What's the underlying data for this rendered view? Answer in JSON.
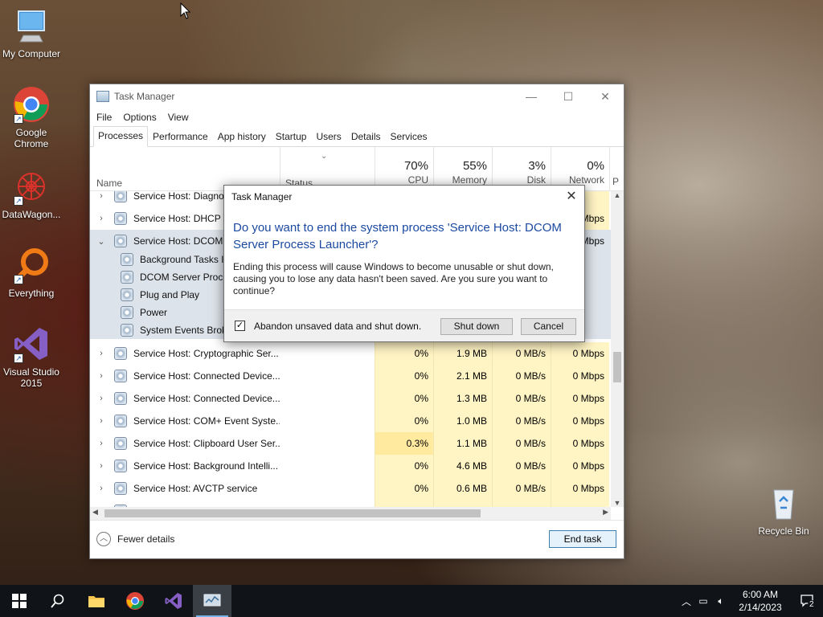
{
  "desktop_icons": [
    {
      "label": "My Computer",
      "icon": "computer-icon"
    },
    {
      "label": "Google Chrome",
      "icon": "chrome-icon"
    },
    {
      "label": "DataWagon...",
      "icon": "datawagon-icon"
    },
    {
      "label": "Everything",
      "icon": "search-magnifier-icon"
    },
    {
      "label": "Visual Studio 2015",
      "icon": "visual-studio-icon"
    },
    {
      "label": "Recycle Bin",
      "icon": "recycle-bin-icon"
    }
  ],
  "task_manager": {
    "title": "Task Manager",
    "menu": [
      "File",
      "Options",
      "View"
    ],
    "tabs": [
      "Processes",
      "Performance",
      "App history",
      "Startup",
      "Users",
      "Details",
      "Services"
    ],
    "active_tab": "Processes",
    "columns": {
      "name": "Name",
      "status": "Status",
      "cpu": {
        "pct": "70%",
        "label": "CPU"
      },
      "memory": {
        "pct": "55%",
        "label": "Memory"
      },
      "disk": {
        "pct": "3%",
        "label": "Disk"
      },
      "network": {
        "pct": "0%",
        "label": "Network"
      },
      "power_label": "P"
    },
    "rows": [
      {
        "chevron": "›",
        "name": "Service Host: Diagno",
        "cpu": "",
        "memory": "",
        "disk": "",
        "network": "",
        "child": false
      },
      {
        "chevron": "›",
        "name": "Service Host: DHCP Cl",
        "cpu": "",
        "memory": "",
        "disk": "",
        "network": "Mbps",
        "child": false
      },
      {
        "chevron": "⌄",
        "name": "Service Host: DCOM S",
        "cpu": "",
        "memory": "",
        "disk": "",
        "network": "Mbps",
        "child": false
      },
      {
        "chevron": "",
        "name": "Background Tasks In",
        "cpu": "",
        "memory": "",
        "disk": "",
        "network": "",
        "child": true
      },
      {
        "chevron": "",
        "name": "DCOM Server Proces",
        "cpu": "",
        "memory": "",
        "disk": "",
        "network": "",
        "child": true
      },
      {
        "chevron": "",
        "name": "Plug and Play",
        "cpu": "",
        "memory": "",
        "disk": "",
        "network": "",
        "child": true
      },
      {
        "chevron": "",
        "name": "Power",
        "cpu": "",
        "memory": "",
        "disk": "",
        "network": "",
        "child": true
      },
      {
        "chevron": "",
        "name": "System Events Broke",
        "cpu": "",
        "memory": "",
        "disk": "",
        "network": "",
        "child": true
      },
      {
        "chevron": "›",
        "name": "Service Host: Cryptographic Ser...",
        "cpu": "0%",
        "memory": "1.9 MB",
        "disk": "0 MB/s",
        "network": "0 Mbps",
        "child": false
      },
      {
        "chevron": "›",
        "name": "Service Host: Connected Device...",
        "cpu": "0%",
        "memory": "2.1 MB",
        "disk": "0 MB/s",
        "network": "0 Mbps",
        "child": false
      },
      {
        "chevron": "›",
        "name": "Service Host: Connected Device...",
        "cpu": "0%",
        "memory": "1.3 MB",
        "disk": "0 MB/s",
        "network": "0 Mbps",
        "child": false
      },
      {
        "chevron": "›",
        "name": "Service Host: COM+ Event Syste...",
        "cpu": "0%",
        "memory": "1.0 MB",
        "disk": "0 MB/s",
        "network": "0 Mbps",
        "child": false
      },
      {
        "chevron": "›",
        "name": "Service Host: Clipboard User Ser...",
        "cpu": "0.3%",
        "memory": "1.1 MB",
        "disk": "0 MB/s",
        "network": "0 Mbps",
        "child": false
      },
      {
        "chevron": "›",
        "name": "Service Host: Background Intelli...",
        "cpu": "0%",
        "memory": "4.6 MB",
        "disk": "0 MB/s",
        "network": "0 Mbps",
        "child": false
      },
      {
        "chevron": "›",
        "name": "Service Host: AVCTP service",
        "cpu": "0%",
        "memory": "0.6 MB",
        "disk": "0 MB/s",
        "network": "0 Mbps",
        "child": false
      },
      {
        "chevron": "›",
        "name": "Service Host: Application Infor...",
        "cpu": "0%",
        "memory": "1.7 MB",
        "disk": "0 MB/s",
        "network": "0 Mbps",
        "child": false
      }
    ],
    "footer": {
      "fewer_details": "Fewer details",
      "end_task": "End task"
    }
  },
  "dialog": {
    "title": "Task Manager",
    "heading": "Do you want to end the system process 'Service Host: DCOM Server Process Launcher'?",
    "body": "Ending this process will cause Windows to become unusable or shut down, causing you to lose any data hasn't been saved. Are you sure you want to continue?",
    "checkbox_label": "Abandon unsaved data and shut down.",
    "checkbox_checked": true,
    "shutdown_button": "Shut down",
    "cancel_button": "Cancel"
  },
  "taskbar": {
    "apps": [
      "windows-start-icon",
      "search-icon",
      "file-explorer-icon",
      "chrome-icon",
      "visual-studio-icon",
      "task-manager-icon"
    ],
    "clock_time": "6:00 AM",
    "clock_date": "2/14/2023",
    "notification_count": "2"
  },
  "colors": {
    "accent": "#1c4aa0",
    "cpu_heat": "#fff4c4",
    "taskbar": "#101418"
  }
}
